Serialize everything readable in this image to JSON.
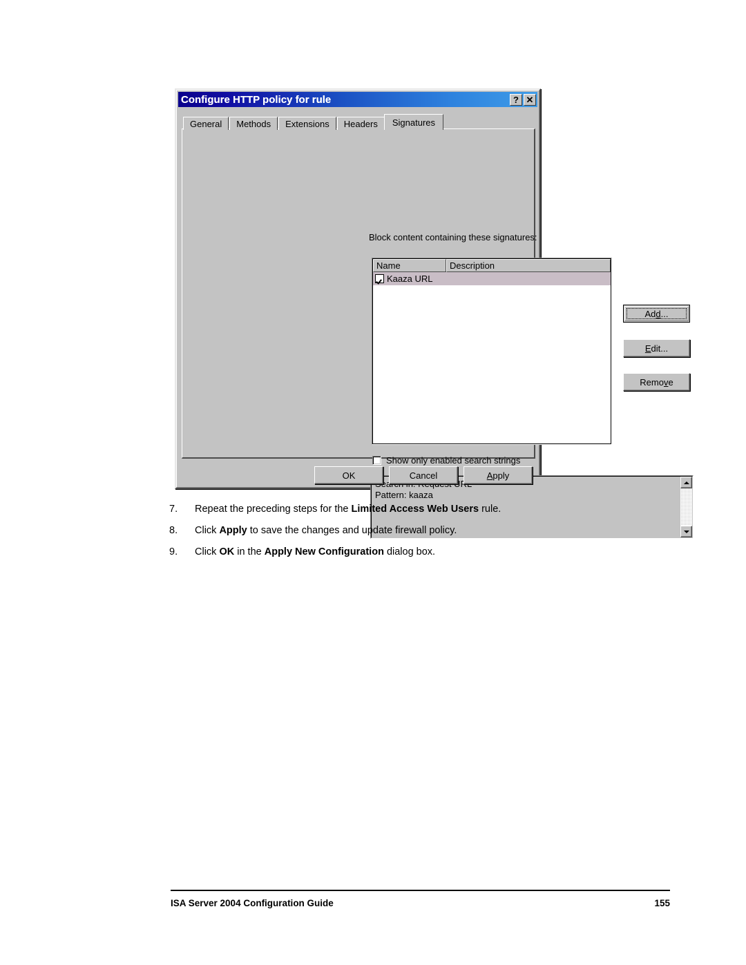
{
  "document": {
    "footer": {
      "title": "ISA Server 2004 Configuration Guide",
      "page_number": "155"
    },
    "steps": [
      {
        "number": "7.",
        "parts": [
          {
            "text": "Repeat the preceding steps for the ",
            "bold": false
          },
          {
            "text": "Limited Access Web Users",
            "bold": true
          },
          {
            "text": " rule.",
            "bold": false
          }
        ]
      },
      {
        "number": "8.",
        "parts": [
          {
            "text": "Click ",
            "bold": false
          },
          {
            "text": "Apply",
            "bold": true
          },
          {
            "text": " to save the changes and update firewall policy.",
            "bold": false
          }
        ]
      },
      {
        "number": "9.",
        "parts": [
          {
            "text": "Click ",
            "bold": false
          },
          {
            "text": "OK",
            "bold": true
          },
          {
            "text": " in the ",
            "bold": false
          },
          {
            "text": "Apply New Configuration",
            "bold": true
          },
          {
            "text": " dialog box.",
            "bold": false
          }
        ]
      }
    ]
  },
  "dialog": {
    "title": "Configure HTTP policy for rule",
    "titlebar_buttons": [
      {
        "name": "help-button",
        "glyph": "?"
      },
      {
        "name": "close-button",
        "glyph": "✕"
      }
    ],
    "tabs": [
      {
        "label": "General",
        "active": false
      },
      {
        "label": "Methods",
        "active": false
      },
      {
        "label": "Extensions",
        "active": false
      },
      {
        "label": "Headers",
        "active": false
      },
      {
        "label": "Signatures",
        "active": true
      }
    ],
    "signatures_tab": {
      "group_label": "Block content containing these signatures:",
      "group_label_accel": "B",
      "list": {
        "columns": [
          "Name",
          "Description"
        ],
        "rows": [
          {
            "checked": true,
            "name": "Kaaza URL",
            "description": "",
            "selected": true
          }
        ]
      },
      "side_buttons": [
        {
          "label": "Add...",
          "accel": "d",
          "default": true
        },
        {
          "label": "Edit...",
          "accel": "E",
          "default": false
        },
        {
          "label": "Remove",
          "accel": "v",
          "default": false
        }
      ],
      "show_only_enabled": {
        "label": "Show only enabled search strings",
        "accel": "h",
        "checked": false
      },
      "details_pane": {
        "line1": "Search in: Request URL",
        "line2": "Pattern: kaaza",
        "scroll_up_icon": "triangle-up-icon",
        "scroll_down_icon": "triangle-down-icon"
      }
    },
    "footer_buttons": [
      {
        "label": "OK",
        "accel": ""
      },
      {
        "label": "Cancel",
        "accel": ""
      },
      {
        "label": "Apply",
        "accel": "A"
      }
    ]
  },
  "colors": {
    "titlebar_start": "#0a008c",
    "titlebar_end": "#3f9ce8",
    "dialog_face": "#c3c3c3",
    "list_selection": "#c9bdc6",
    "text": "#000000",
    "page_background": "#ffffff"
  }
}
